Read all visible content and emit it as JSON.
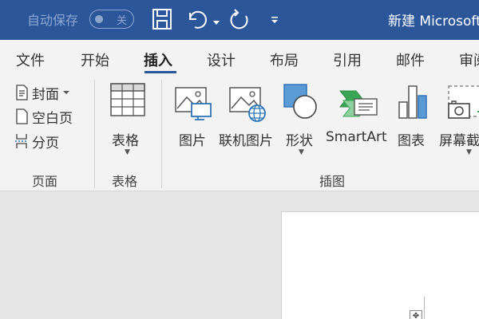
{
  "titlebar": {
    "autosave_label": "自动保存",
    "autosave_state": "关",
    "doc_title": "新建 Microsoft"
  },
  "tabs": [
    {
      "label": "文件"
    },
    {
      "label": "开始"
    },
    {
      "label": "插入",
      "active": true
    },
    {
      "label": "设计"
    },
    {
      "label": "布局"
    },
    {
      "label": "引用"
    },
    {
      "label": "邮件"
    },
    {
      "label": "审阅"
    }
  ],
  "ribbon": {
    "pages": {
      "cover": "封面",
      "blank": "空白页",
      "break": "分页",
      "group": "页面"
    },
    "tables": {
      "table": "表格",
      "group": "表格"
    },
    "illustrations": {
      "picture": "图片",
      "online_picture": "联机图片",
      "shapes": "形状",
      "smartart": "SmartArt",
      "chart": "图表",
      "screenshot": "屏幕截图",
      "group": "插图"
    }
  },
  "colors": {
    "titlebar": "#2b579a",
    "ribbon": "#f3f3f3",
    "accent_green": "#3aa655",
    "accent_blue": "#2e75b6"
  }
}
